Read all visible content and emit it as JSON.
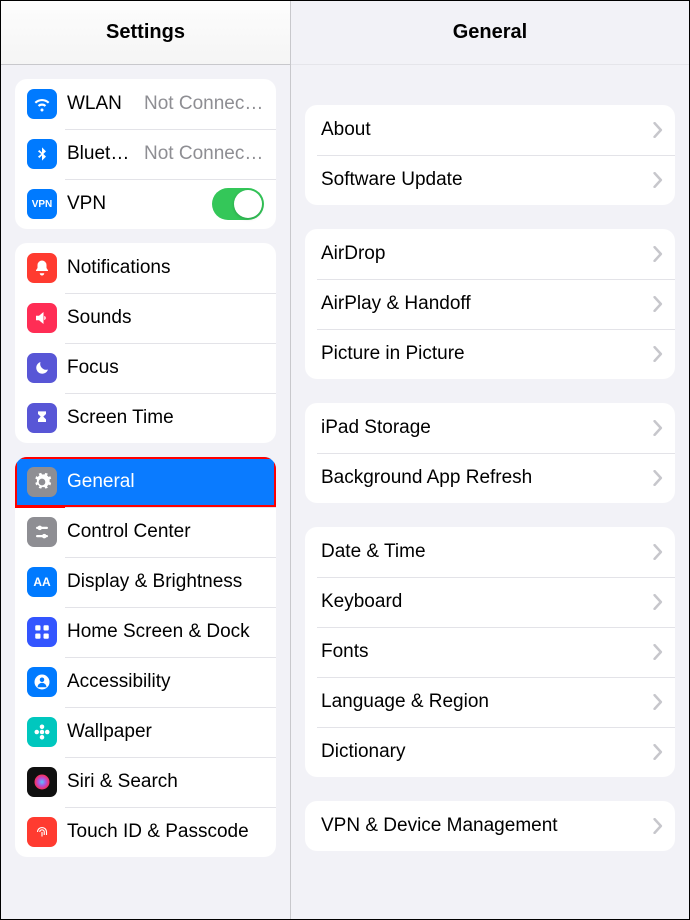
{
  "sidebar": {
    "title": "Settings",
    "groups": [
      {
        "items": [
          {
            "id": "wlan",
            "label": "WLAN",
            "value": "Not Connected",
            "icon": "wifi-icon",
            "iconClass": "ic-wlan"
          },
          {
            "id": "bluetooth",
            "label": "Bluetooth",
            "value": "Not Connected",
            "icon": "bluetooth-icon",
            "iconClass": "ic-bluetooth"
          },
          {
            "id": "vpn",
            "label": "VPN",
            "toggle": true,
            "toggle_on": true,
            "icon": "vpn-icon",
            "iconClass": "ic-vpn",
            "iconText": "VPN"
          }
        ]
      },
      {
        "items": [
          {
            "id": "notifications",
            "label": "Notifications",
            "icon": "bell-icon",
            "iconClass": "ic-notif"
          },
          {
            "id": "sounds",
            "label": "Sounds",
            "icon": "speaker-icon",
            "iconClass": "ic-sounds"
          },
          {
            "id": "focus",
            "label": "Focus",
            "icon": "moon-icon",
            "iconClass": "ic-focus"
          },
          {
            "id": "screen-time",
            "label": "Screen Time",
            "icon": "hourglass-icon",
            "iconClass": "ic-screentime"
          }
        ]
      },
      {
        "items": [
          {
            "id": "general",
            "label": "General",
            "icon": "gear-icon",
            "iconClass": "ic-general",
            "selected": true,
            "highlight": true
          },
          {
            "id": "control-center",
            "label": "Control Center",
            "icon": "sliders-icon",
            "iconClass": "ic-control"
          },
          {
            "id": "display",
            "label": "Display & Brightness",
            "icon": "display-icon",
            "iconClass": "ic-display",
            "iconText": "AA"
          },
          {
            "id": "home-screen",
            "label": "Home Screen & Dock",
            "icon": "grid-icon",
            "iconClass": "ic-home"
          },
          {
            "id": "accessibility",
            "label": "Accessibility",
            "icon": "person-icon",
            "iconClass": "ic-access"
          },
          {
            "id": "wallpaper",
            "label": "Wallpaper",
            "icon": "flower-icon",
            "iconClass": "ic-wallpaper"
          },
          {
            "id": "siri",
            "label": "Siri & Search",
            "icon": "siri-icon",
            "iconClass": "ic-siri"
          },
          {
            "id": "touchid",
            "label": "Touch ID & Passcode",
            "icon": "fingerprint-icon",
            "iconClass": "ic-touchid"
          }
        ]
      }
    ]
  },
  "detail": {
    "title": "General",
    "groups": [
      {
        "items": [
          {
            "id": "about",
            "label": "About"
          },
          {
            "id": "software-update",
            "label": "Software Update"
          }
        ]
      },
      {
        "items": [
          {
            "id": "airdrop",
            "label": "AirDrop"
          },
          {
            "id": "airplay",
            "label": "AirPlay & Handoff"
          },
          {
            "id": "pip",
            "label": "Picture in Picture"
          }
        ]
      },
      {
        "items": [
          {
            "id": "storage",
            "label": "iPad Storage"
          },
          {
            "id": "background-refresh",
            "label": "Background App Refresh"
          }
        ]
      },
      {
        "items": [
          {
            "id": "date-time",
            "label": "Date & Time"
          },
          {
            "id": "keyboard",
            "label": "Keyboard"
          },
          {
            "id": "fonts",
            "label": "Fonts"
          },
          {
            "id": "language",
            "label": "Language & Region"
          },
          {
            "id": "dictionary",
            "label": "Dictionary"
          }
        ]
      },
      {
        "items": [
          {
            "id": "vpn-mgmt",
            "label": "VPN & Device Management"
          }
        ]
      }
    ]
  }
}
